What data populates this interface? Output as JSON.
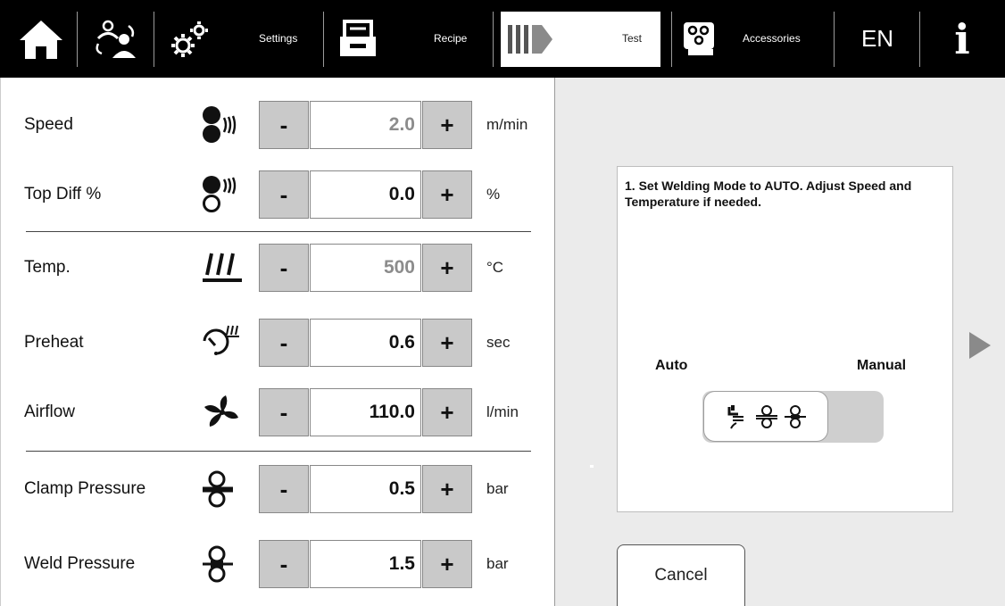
{
  "nav": {
    "items": [
      {
        "name": "home",
        "icon": "home-icon",
        "label": ""
      },
      {
        "name": "user-mode",
        "icon": "user-mode-icon",
        "label": ""
      },
      {
        "name": "settings",
        "icon": "gears-icon",
        "label": "Settings"
      },
      {
        "name": "recipe",
        "icon": "recipe-icon",
        "label": "Recipe"
      },
      {
        "name": "test",
        "icon": "test-arrow-icon",
        "label": "Test",
        "active": true
      },
      {
        "name": "accessories",
        "icon": "accessories-icon",
        "label": "Accessories"
      }
    ],
    "language": "EN",
    "info": "i"
  },
  "params": [
    {
      "label": "Speed",
      "icon": "speed-icon",
      "minus": "-",
      "plus": "+",
      "value": "2.0",
      "unit": "m/min",
      "dim": true
    },
    {
      "label": "Top Diff %",
      "icon": "top-diff-icon",
      "minus": "-",
      "plus": "+",
      "value": "0.0",
      "unit": "%",
      "dim": false
    },
    {
      "label": "Temp.",
      "icon": "temperature-icon",
      "minus": "-",
      "plus": "+",
      "value": "500",
      "unit": "°C",
      "dim": true
    },
    {
      "label": "Preheat",
      "icon": "preheat-icon",
      "minus": "-",
      "plus": "+",
      "value": "0.6",
      "unit": "sec",
      "dim": false
    },
    {
      "label": "Airflow",
      "icon": "airflow-fan-icon",
      "minus": "-",
      "plus": "+",
      "value": "110.0",
      "unit": "l/min",
      "dim": false
    },
    {
      "label": "Clamp Pressure",
      "icon": "clamp-pressure-icon",
      "minus": "-",
      "plus": "+",
      "value": "0.5",
      "unit": "bar",
      "dim": false
    },
    {
      "label": "Weld Pressure",
      "icon": "weld-pressure-icon",
      "minus": "-",
      "plus": "+",
      "value": "1.5",
      "unit": "bar",
      "dim": false
    }
  ],
  "instruction": {
    "text": "1. Set Welding Mode to AUTO. Adjust Speed and Temperature if needed.",
    "mode_auto": "Auto",
    "mode_manual": "Manual",
    "toggle_state": "auto"
  },
  "cancel_label": "Cancel",
  "colors": {
    "nav_bg": "#000000",
    "button_bg": "#c9c9c9",
    "right_panel_bg": "#ebebeb",
    "dim_value": "#8c8c8c"
  }
}
